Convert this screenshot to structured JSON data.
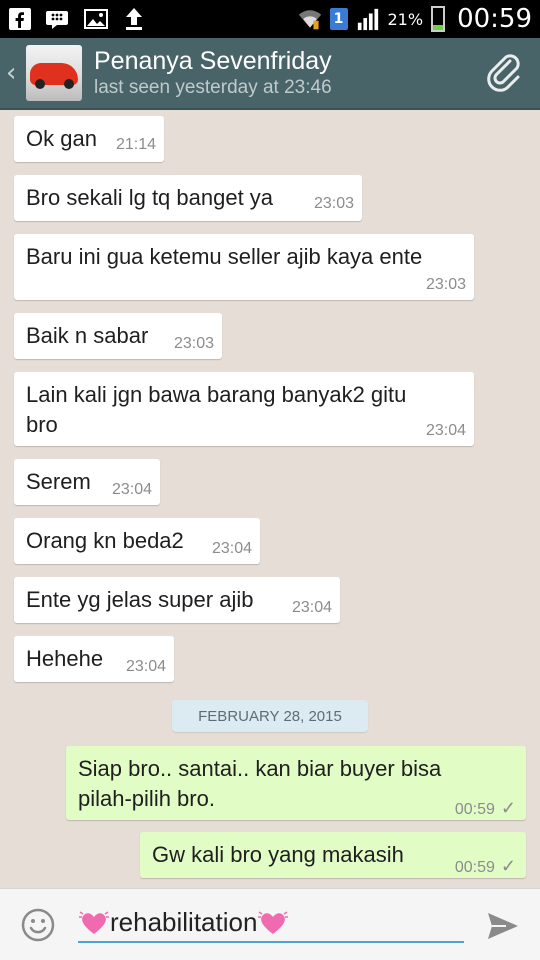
{
  "status_bar": {
    "notification_badge": "1",
    "battery_percent": "21%",
    "time": "00:59",
    "icons": [
      "facebook-icon",
      "blackberry-messenger-icon",
      "gallery-icon",
      "upload-icon",
      "wifi-icon",
      "signal-icon",
      "battery-icon"
    ]
  },
  "header": {
    "contact_name": "Penanya Sevenfriday",
    "last_seen": "last seen yesterday at 23:46",
    "attach_icon": "paperclip-icon",
    "accent_color": "#496468"
  },
  "messages": [
    {
      "direction": "in",
      "text": "Ok gan",
      "time": "21:14"
    },
    {
      "direction": "in",
      "text": "Bro sekali lg tq banget ya",
      "time": "23:03"
    },
    {
      "direction": "in",
      "text": "Baru ini gua ketemu seller ajib kaya ente",
      "time": "23:03"
    },
    {
      "direction": "in",
      "text": "Baik n sabar",
      "time": "23:03"
    },
    {
      "direction": "in",
      "text": "Lain kali jgn bawa barang banyak2 gitu bro",
      "time": "23:04"
    },
    {
      "direction": "in",
      "text": "Serem",
      "time": "23:04"
    },
    {
      "direction": "in",
      "text": "Orang kn beda2",
      "time": "23:04"
    },
    {
      "direction": "in",
      "text": "Ente yg jelas super ajib",
      "time": "23:04"
    },
    {
      "direction": "in",
      "text": "Hehehe",
      "time": "23:04"
    }
  ],
  "date_separator": "FEBRUARY 28, 2015",
  "outgoing_messages": [
    {
      "text": "Siap bro.. santai.. kan biar buyer bisa pilah-pilih bro.",
      "time": "00:59",
      "status": "sent"
    },
    {
      "text": "Gw kali bro yang makasih",
      "time": "00:59",
      "status": "sent"
    }
  ],
  "composer": {
    "value": "rehabilitation",
    "emoji_icon": "smiley-icon",
    "send_icon": "send-icon",
    "decoration": "pink-heart-emoji"
  },
  "colors": {
    "incoming_bubble": "#ffffff",
    "outgoing_bubble": "#e2fcc6",
    "chat_background": "#e6ded6",
    "input_underline": "#4aa3d9"
  }
}
